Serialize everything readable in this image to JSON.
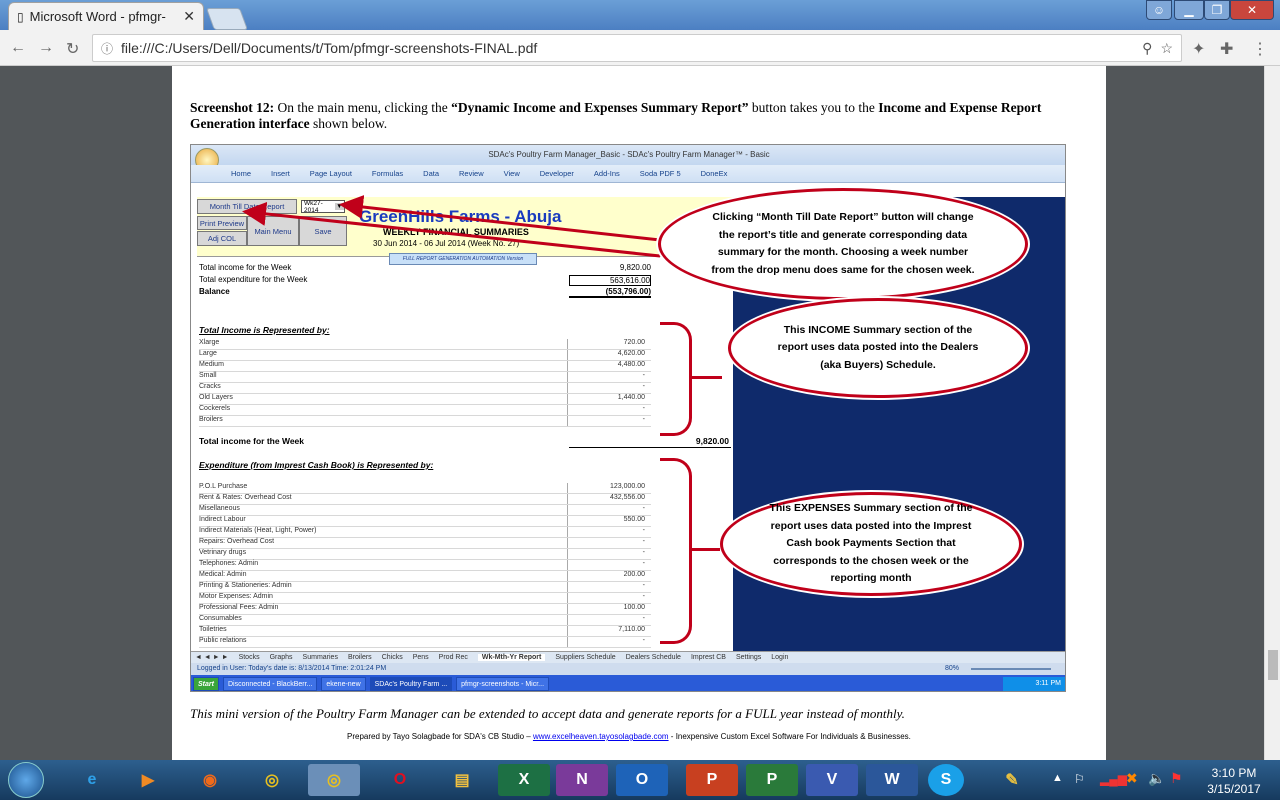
{
  "browser": {
    "tab_title": "Microsoft Word - pfmgr-",
    "url": "file:///C:/Users/Dell/Documents/t/Tom/pfmgr-screenshots-FINAL.pdf",
    "close": "✕"
  },
  "doc": {
    "intro_bold1": "Screenshot 12:",
    "intro_text1": " On the main menu, clicking the ",
    "intro_bold2": "“Dynamic Income and Expenses Summary Report”",
    "intro_text2": " button takes you to the ",
    "intro_bold3": "Income and Expense Report Generation  interface",
    "intro_text3": " shown below.",
    "footer_italic": "This mini version of the Poultry Farm Manager can be extended to accept data and generate reports for a FULL year instead of monthly.",
    "credit_pre": "Prepared by Tayo Solagbade for SDA's CB Studio – ",
    "credit_link": "www.excelheaven.tayosolagbade.com",
    "credit_post": " - Inexpensive Custom Excel Software For Individuals & Businesses."
  },
  "excel": {
    "title": "SDAc's Poultry Farm Manager_Basic - SDAc's Poultry Farm Manager™ - Basic",
    "ribbon": [
      "Home",
      "Insert",
      "Page Layout",
      "Formulas",
      "Data",
      "Review",
      "View",
      "Developer",
      "Add-Ins",
      "Soda PDF 5",
      "DoneEx"
    ],
    "btn_mtd": "Month Till Date Report",
    "week_select": "Wk27-2014",
    "btn_print": "Print Preview",
    "btn_main": "Main Menu",
    "btn_save": "Save",
    "btn_adj": "Adj COL",
    "farm": "GreenHills Farms - Abuja",
    "report_title": "WEEKLY FINANCIAL SUMMARIES",
    "period": "30 Jun 2014 - 06 Jul 2014 (Week No. 27)",
    "automation": "FULL REPORT GENERATION  AUTOMATION  Version",
    "summary": [
      {
        "label": "Total income for the Week",
        "value": "9,820.00"
      },
      {
        "label": "Total expenditure for the Week",
        "value": "563,616.00"
      },
      {
        "label": "Balance",
        "value": "(553,796.00)"
      }
    ],
    "income_heading": "Total Income is Represented by:",
    "income_rows": [
      {
        "label": "Xlarge",
        "value": "720.00"
      },
      {
        "label": "Large",
        "value": "4,620.00"
      },
      {
        "label": "Medium",
        "value": "4,480.00"
      },
      {
        "label": "Small",
        "value": "-"
      },
      {
        "label": "Cracks",
        "value": "-"
      },
      {
        "label": "Old Layers",
        "value": "1,440.00"
      },
      {
        "label": "Cockerels",
        "value": "-"
      },
      {
        "label": "Broilers",
        "value": "-"
      }
    ],
    "income_total_label": "Total income for the Week",
    "income_total": "9,820.00",
    "exp_heading": "Expenditure (from Imprest Cash Book) is Represented by:",
    "exp_rows": [
      {
        "label": "P.O.L Purchase",
        "value": "123,000.00"
      },
      {
        "label": "Rent & Rates: Overhead Cost",
        "value": "432,556.00"
      },
      {
        "label": "Misellaneous",
        "value": "-"
      },
      {
        "label": "Indirect Labour",
        "value": "550.00"
      },
      {
        "label": "Indirect Materials (Heat, Light, Power)",
        "value": "-"
      },
      {
        "label": "Repairs: Overhead Cost",
        "value": "-"
      },
      {
        "label": "Vetrinary drugs",
        "value": "-"
      },
      {
        "label": "Telephones: Admin",
        "value": "-"
      },
      {
        "label": "Medical: Admin",
        "value": "200.00"
      },
      {
        "label": "Printing & Stationeries: Admin",
        "value": "-"
      },
      {
        "label": "Motor Expenses: Admin",
        "value": "-"
      },
      {
        "label": "Professional Fees: Admin",
        "value": "100.00"
      },
      {
        "label": "Consumables",
        "value": "-"
      },
      {
        "label": "Toiletries",
        "value": "7,110.00"
      },
      {
        "label": "Public relations",
        "value": "-"
      }
    ],
    "sheet_tabs": [
      "Stocks",
      "Graphs",
      "Summaries",
      "Broilers",
      "Chicks",
      "Pens",
      "Prod Rec",
      "Wk-Mth-Yr Report",
      "Suppliers Schedule",
      "Dealers Schedule",
      "Imprest CB",
      "Settings",
      "Login"
    ],
    "status": "Logged in User:  Today's date is: 8/13/2014 Time: 2:01:24 PM",
    "zoom": "80%",
    "tasks": [
      "Start",
      "Disconnected - BlackBerr...",
      "ekene-new",
      "SDAc's Poultry Farm ...",
      "pfmgr-screenshots - Micr..."
    ],
    "xl_clock": "3:11 PM"
  },
  "callouts": {
    "c1": "Clicking “Month Till Date Report” button will change the report’s title and generate corresponding data summary for the month. Choosing a week number from the drop menu does same for the chosen week.",
    "c2": "This INCOME Summary section of the report uses data posted into the Dealers (aka Buyers) Schedule.",
    "c3": "This EXPENSES Summary section of the report uses data posted into the Imprest Cash book Payments Section that corresponds to the chosen week or the reporting month"
  },
  "taskbar": {
    "time": "3:10 PM",
    "date": "3/15/2017"
  },
  "colors": {
    "callout_red": "#c0001a",
    "excel_blue": "#0f2a6b",
    "banner_yellow": "#ffffcc"
  }
}
